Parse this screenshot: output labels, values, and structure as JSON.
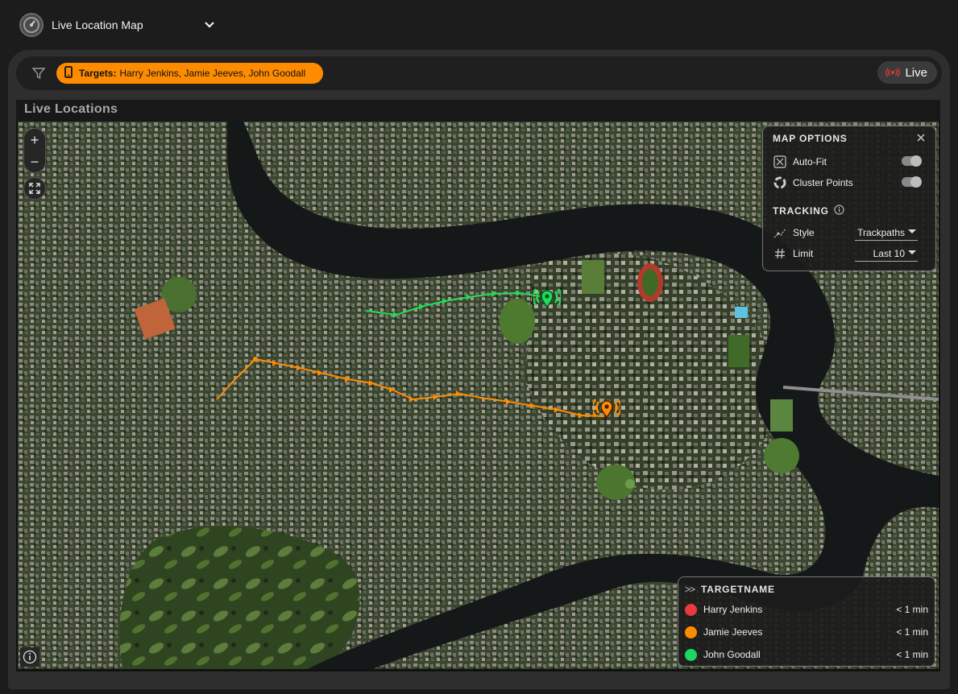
{
  "header": {
    "title": "Live Location Map"
  },
  "filter": {
    "targets_label": "Targets:",
    "targets_value": "Harry Jenkins, Jamie Jeeves, John Goodall",
    "live_label": "Live"
  },
  "map": {
    "section_title": "Live Locations",
    "zoom_in": "+",
    "zoom_out": "−"
  },
  "options": {
    "title": "MAP OPTIONS",
    "auto_fit_label": "Auto-Fit",
    "auto_fit_on": false,
    "cluster_label": "Cluster Points",
    "cluster_on": false,
    "tracking_title": "TRACKING",
    "style_label": "Style",
    "style_value": "Trackpaths",
    "limit_label": "Limit",
    "limit_value": "Last 10"
  },
  "legend": {
    "header": "TARGETNAME",
    "expand_glyph": ">>",
    "targets": [
      {
        "name": "Harry Jenkins",
        "time": "< 1 min",
        "color": "#e8393d"
      },
      {
        "name": "Jamie Jeeves",
        "time": "< 1 min",
        "color": "#ff8c00"
      },
      {
        "name": "John Goodall",
        "time": "< 1 min",
        "color": "#1ed760"
      }
    ]
  },
  "colors": {
    "accent": "#ff8c00",
    "live_red": "#e53935",
    "track_green": "#22dd55",
    "track_orange": "#ff8c00"
  }
}
